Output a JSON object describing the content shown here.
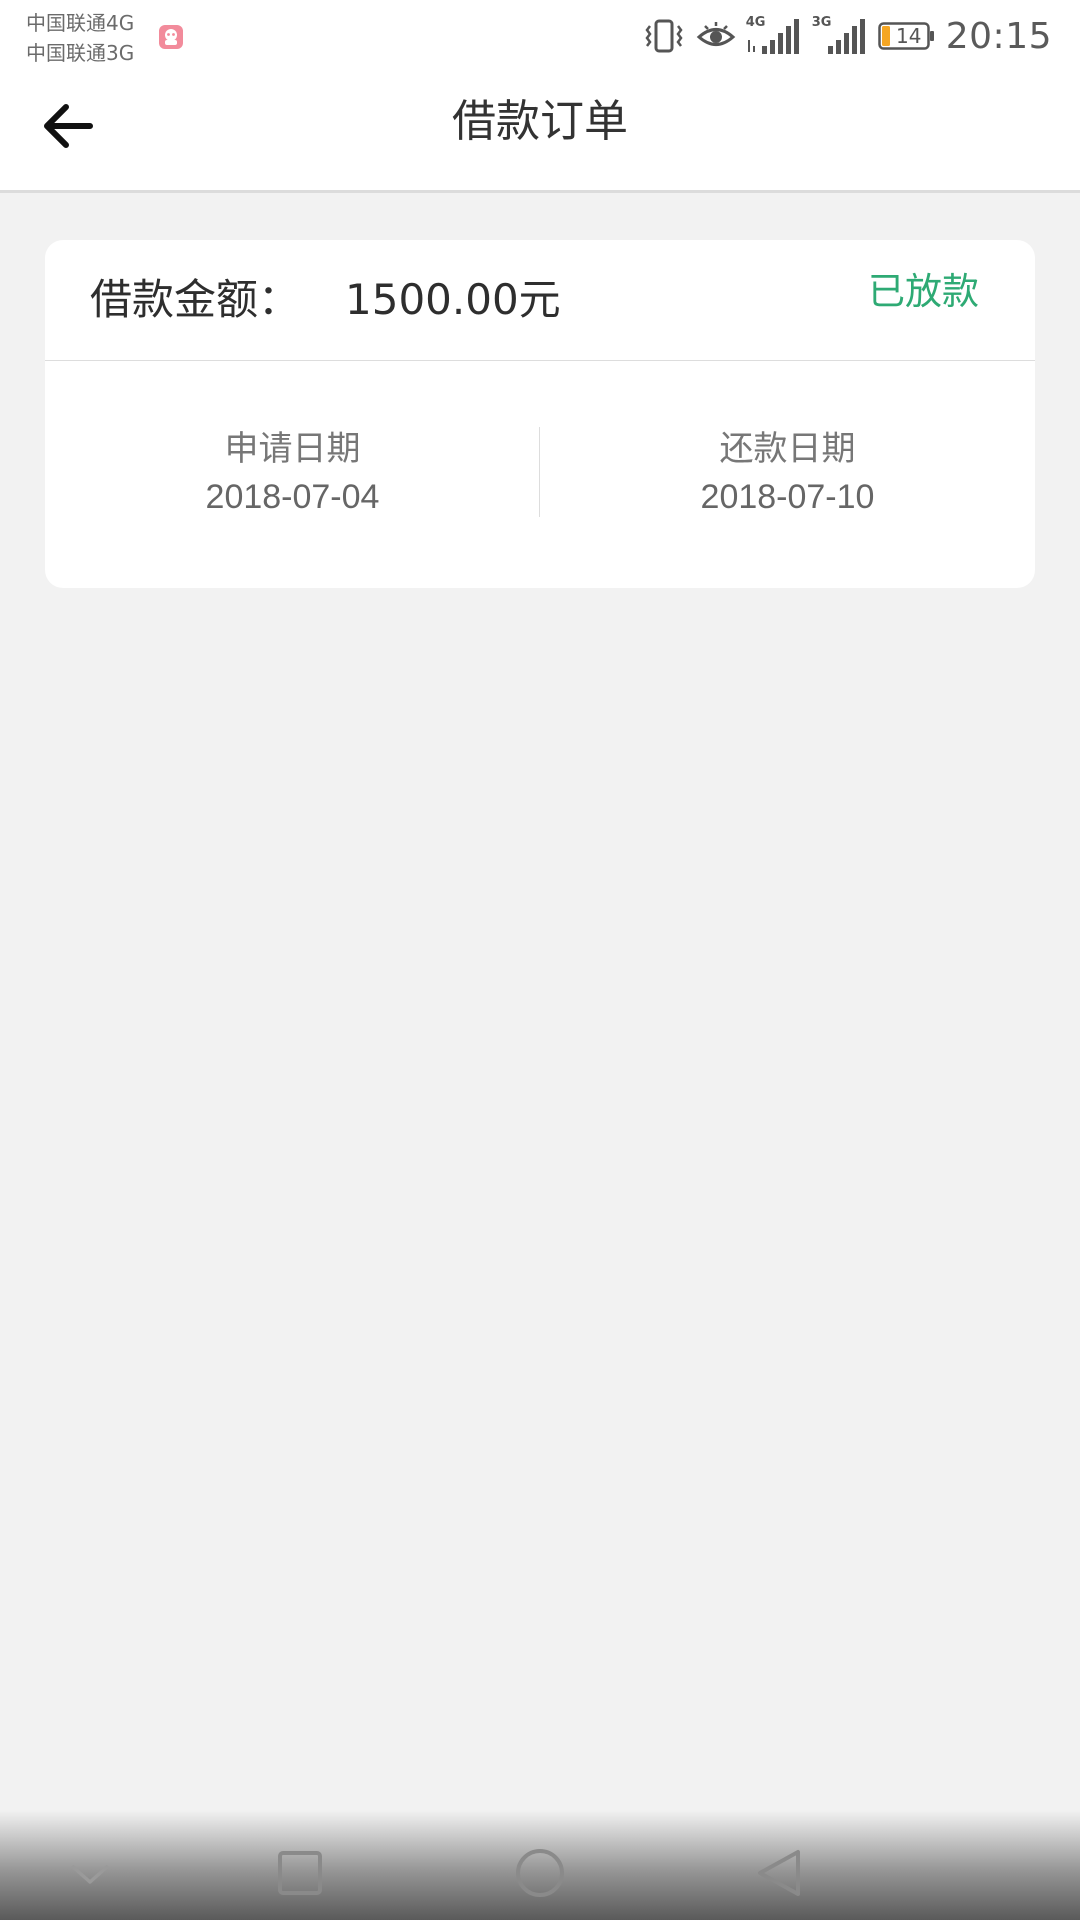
{
  "status_bar": {
    "carrier_1": "中国联通4G",
    "carrier_2": "中国联通3G",
    "signal_1_label": "4G",
    "signal_2_label": "3G",
    "battery_level": "14",
    "time": "20:15"
  },
  "app_bar": {
    "title": "借款订单"
  },
  "order": {
    "amount_label": "借款金额：",
    "amount_value": "1500.00元",
    "status": "已放款",
    "apply_date_label": "申请日期",
    "apply_date": "2018-07-04",
    "repay_date_label": "还款日期",
    "repay_date": "2018-07-10"
  },
  "theme": {
    "accent_green": "#2eaa74",
    "background": "#f2f2f2",
    "card": "#ffffff",
    "battery_orange": "#f5a623"
  },
  "icons": {
    "back": "arrow-left-icon",
    "notification": "app-notification-icon",
    "vibrate": "vibrate-icon",
    "eye_comfort": "eye-icon",
    "nav_down": "chevron-down-icon",
    "nav_recents": "square-icon",
    "nav_home": "circle-icon",
    "nav_back": "triangle-back-icon"
  }
}
